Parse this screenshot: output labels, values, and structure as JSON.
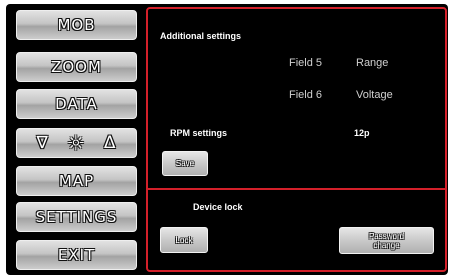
{
  "menu": {
    "mob": "MOB",
    "zoom": "ZOOM",
    "data": "DATA",
    "brightness": {
      "down_icon": "∇",
      "sun_icon": "☼",
      "up_icon": "Δ"
    },
    "map": "MAP",
    "settings": "SETTINGS",
    "exit": "EXIT"
  },
  "additional_settings": {
    "title": "Additional settings",
    "field5_label": "Field 5",
    "field5_value": "Range",
    "field6_label": "Field 6",
    "field6_value": "Voltage"
  },
  "rpm_settings": {
    "label": "RPM settings",
    "value": "12p",
    "save_label": "Save"
  },
  "device_lock": {
    "title": "Device lock",
    "lock_label": "Lock",
    "password_change_label": "Password change"
  },
  "colors": {
    "background": "#000000",
    "panel_border": "#d4202a",
    "button_face": "#c4c4c4"
  }
}
